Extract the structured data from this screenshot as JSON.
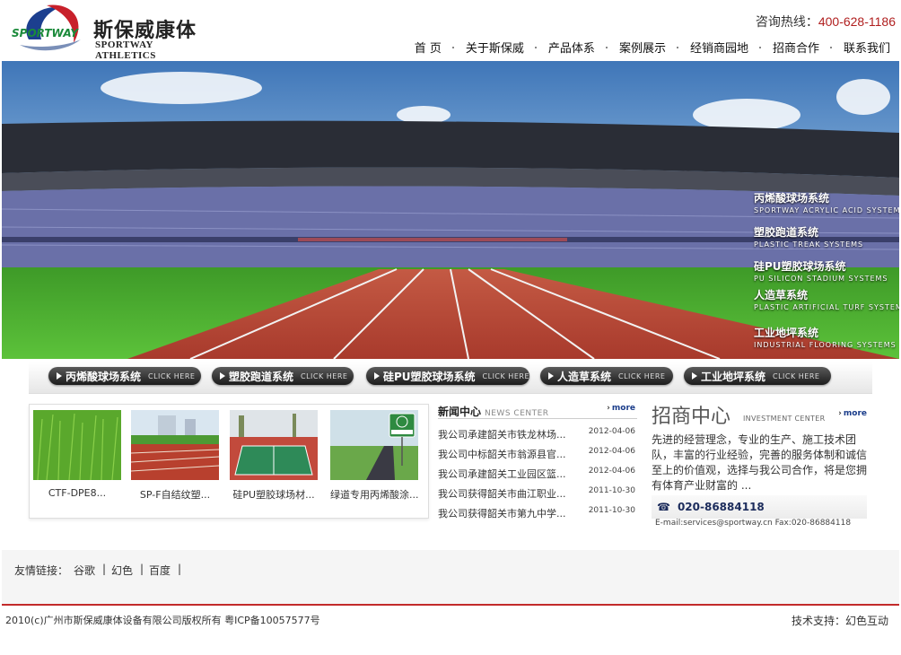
{
  "header": {
    "brand_cn": "斯保威康体",
    "brand_en": "SPORTWAY ATHLETICS",
    "logo_text": "SPORTWAY",
    "hotline_label": "咨询热线：",
    "hotline_number": "400-628-1186",
    "nav": [
      "首 页",
      "关于斯保威",
      "产品体系",
      "案例展示",
      "经销商园地",
      "招商合作",
      "联系我们"
    ]
  },
  "banner": {
    "menu": [
      {
        "cn": "丙烯酸球场系统",
        "en": "SPORTWAY ACRYLIC ACID SYSTEMS"
      },
      {
        "cn": "塑胶跑道系统",
        "en": "PLASTIC TREAK SYSTEMS"
      },
      {
        "cn": "硅PU塑胶球场系统",
        "en": "PU SILICON STADIUM SYSTEMS"
      },
      {
        "cn": "人造草系统",
        "en": "PLASTIC ARTIFICIAL TURF SYSTEMS"
      },
      {
        "cn": "工业地坪系统",
        "en": "INDUSTRIAL FLOORING SYSTEMS"
      }
    ]
  },
  "pills": {
    "click_label": "CLICK HERE",
    "items": [
      "丙烯酸球场系统",
      "塑胶跑道系统",
      "硅PU塑胶球场系统",
      "人造草系统",
      "工业地坪系统"
    ]
  },
  "products": [
    "CTF-DPE8...",
    "SP-F自结纹塑...",
    "硅PU塑胶球场材...",
    "绿道专用丙烯酸涂..."
  ],
  "news": {
    "title": "新闻中心",
    "title_en": "NEWS CENTER",
    "more": "more",
    "items": [
      {
        "title": "我公司承建韶关市铁龙林场...",
        "date": "2012-04-06"
      },
      {
        "title": "我公司中标韶关市翁源县官...",
        "date": "2012-04-06"
      },
      {
        "title": "我公司承建韶关工业园区篮...",
        "date": "2012-04-06"
      },
      {
        "title": "我公司获得韶关市曲江职业...",
        "date": "2011-10-30"
      },
      {
        "title": "我公司获得韶关市第九中学...",
        "date": "2011-10-30"
      }
    ]
  },
  "invest": {
    "title": "招商中心",
    "title_en": "INVESTMENT CENTER",
    "more": "more",
    "body": "先进的经营理念，专业的生产、施工技术团队，丰富的行业经验，完善的服务体制和诚信至上的价值观，选择与我公司合作，将是您拥有体育产业财富的 ...",
    "tel": "020-86884118",
    "mail": "E-mail:services@sportway.cn Fax:020-86884118"
  },
  "links": {
    "label": "友情链接：",
    "items": [
      "谷歌",
      "幻色",
      "百度"
    ]
  },
  "footer": {
    "copyright": "2010(c)广州市斯保威康体设备有限公司版权所有 粤ICP备10057577号",
    "tech": "技术支持：幻色互动"
  },
  "colors": {
    "accent_red": "#b01f1f",
    "footer_line": "#c22a2a",
    "more_blue": "#1a3c8a"
  }
}
